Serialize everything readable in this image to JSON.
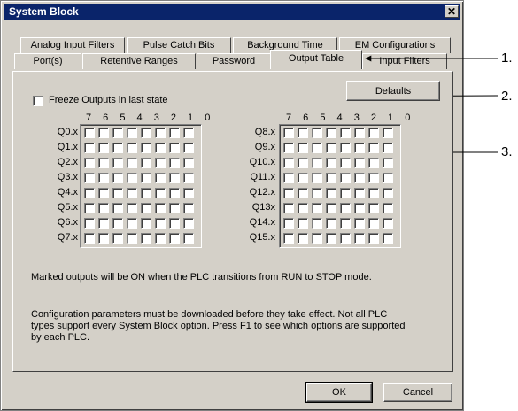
{
  "window": {
    "title": "System Block",
    "close_glyph": "✕"
  },
  "tabs_back": [
    "Analog Input Filters",
    "Pulse Catch Bits",
    "Background Time",
    "EM Configurations"
  ],
  "tabs_front": [
    "Port(s)",
    "Retentive Ranges",
    "Password",
    "Output Table",
    "Input Filters"
  ],
  "active_tab": "Output Table",
  "freeze": {
    "label": "Freeze Outputs in last state",
    "checked": false
  },
  "defaults_button": "Defaults",
  "bit_header": "7 6 5 4 3 2 1 0",
  "left_rows": [
    "Q0.x",
    "Q1.x",
    "Q2.x",
    "Q3.x",
    "Q4.x",
    "Q5.x",
    "Q6.x",
    "Q7.x"
  ],
  "right_rows": [
    "Q8.x",
    "Q9.x",
    "Q10.x",
    "Q11.x",
    "Q12.x",
    "Q13x",
    "Q14.x",
    "Q15.x"
  ],
  "note": "Marked outputs will be ON when the PLC transitions from RUN to STOP mode.",
  "config_note": "Configuration parameters must be downloaded before they take effect. Not all PLC types support every System Block option.  Press F1 to see which options are supported by each PLC.",
  "buttons": {
    "ok": "OK",
    "cancel": "Cancel"
  },
  "annotations": [
    "1.",
    "2.",
    "3."
  ]
}
